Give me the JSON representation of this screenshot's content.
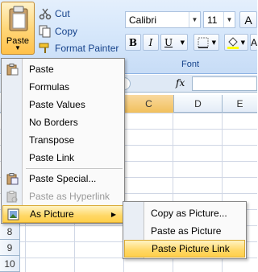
{
  "ribbon": {
    "clipboard": {
      "paste_label": "Paste",
      "cut_label": "Cut",
      "copy_label": "Copy",
      "format_painter_label": "Format Painter"
    },
    "font": {
      "font_name": "Calibri",
      "font_size": "11",
      "bold": "B",
      "italic": "I",
      "underline": "U",
      "group_label": "Font",
      "font_color": "#ff0000",
      "fill_color": "#ffff00"
    }
  },
  "formula_bar": {
    "fx": "fx"
  },
  "columns": [
    "C",
    "D",
    "E"
  ],
  "rows": [
    "8",
    "9",
    "10"
  ],
  "paste_menu": {
    "items": [
      {
        "label": "Paste",
        "icon": "paste-icon"
      },
      {
        "label": "Formulas"
      },
      {
        "label": "Paste Values"
      },
      {
        "label": "No Borders"
      },
      {
        "label": "Transpose"
      },
      {
        "label": "Paste Link"
      },
      {
        "label": "Paste Special...",
        "icon": "paste-special-icon"
      },
      {
        "label": "Paste as Hyperlink",
        "icon": "paste-hyperlink-icon",
        "disabled": true
      },
      {
        "label": "As Picture",
        "icon": "picture-icon",
        "highlighted": true
      }
    ]
  },
  "as_picture_submenu": {
    "items": [
      {
        "label": "Copy as Picture..."
      },
      {
        "label": "Paste as Picture"
      },
      {
        "label": "Paste Picture Link",
        "highlighted": true
      }
    ]
  }
}
